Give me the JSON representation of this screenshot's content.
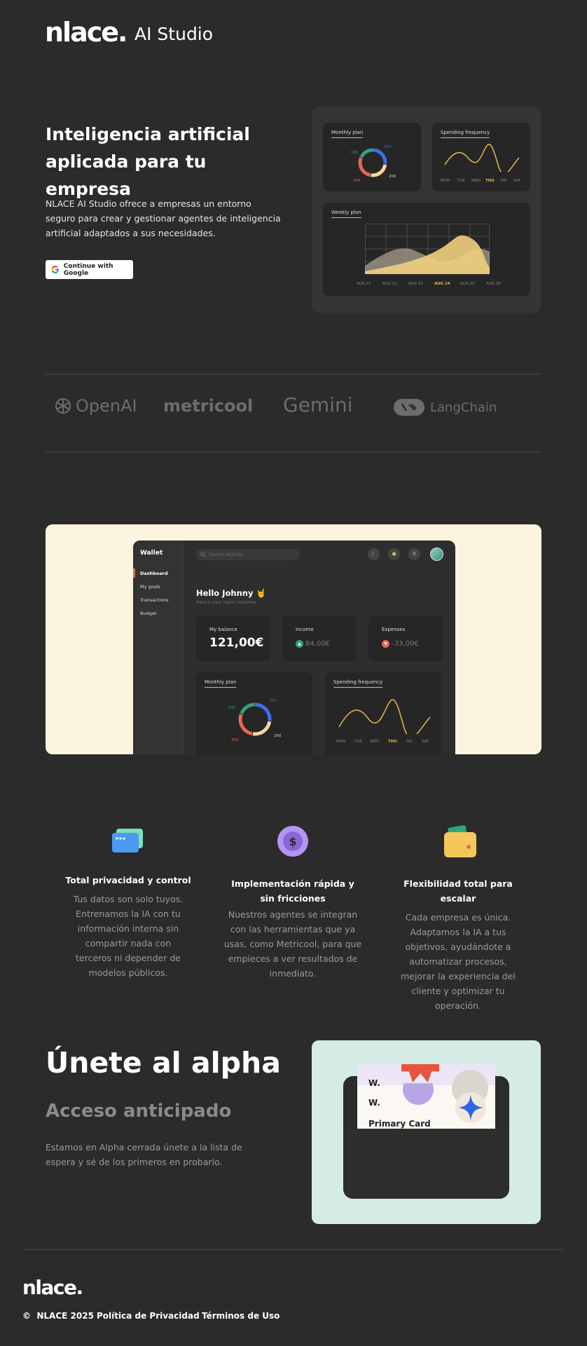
{
  "header": {
    "logo": "nlace.",
    "logo_sub": "AI Studio"
  },
  "hero": {
    "title": "Inteligencia artificial aplicada para tu empresa",
    "description": "NLACE AI Studio ofrece a empresas un entorno seguro para crear y gestionar agentes de inteligencia artificial adaptados a sus necesidades.",
    "google_button": "Continue with Google",
    "monthly_card": {
      "title": "Monthly plan",
      "labels": [
        "100",
        "300",
        "300",
        "200"
      ]
    },
    "spending_card": {
      "title": "Spending frequency",
      "days": [
        "MON",
        "TUE",
        "WED",
        "THU",
        "FRI",
        "SAT"
      ],
      "active_day": "THU"
    },
    "weekly_card": {
      "title": "Weekly plan",
      "dates": [
        "AUG 21",
        "AUG 22",
        "AUG 23",
        "AUG 24",
        "AUG 25",
        "AUG 26"
      ],
      "active_date": "AUG 24"
    }
  },
  "partners": [
    "OpenAI",
    "metricool",
    "Gemini",
    "LangChain"
  ],
  "showcase": {
    "app_title": "Wallet",
    "nav": [
      "Dashboard",
      "My goals",
      "Transactions",
      "Budget"
    ],
    "search_placeholder": "Search Activity",
    "greeting": "Hello Johnny 🤘",
    "greeting_sub": "Here is your report overview",
    "balance_label": "My balance",
    "balance_value": "121,00€",
    "income_label": "Income",
    "income_value": "84,00€",
    "expenses_label": "Expenses",
    "expenses_value": "-33,00€",
    "monthly_title": "Monthly plan",
    "monthly_labels": [
      "100",
      "300",
      "300",
      "200"
    ],
    "spending_title": "Spending frequency",
    "days": [
      "MON",
      "TUE",
      "WED",
      "THU",
      "FRI",
      "SAT"
    ]
  },
  "features": [
    {
      "title": "Total privacidad y control",
      "description": "Tus datos son solo tuyos. Entrenamos la IA con tu información interna sin compartir nada con terceros ni depender de modelos públicos."
    },
    {
      "title": "Implementación rápida y sin fricciones",
      "description": "Nuestros agentes se integran con las herramientas que ya usas, como Metricool, para que empieces a ver resultados de inmediato."
    },
    {
      "title": "Flexibilidad total para escalar",
      "description": "Cada empresa es única. Adaptamos la IA a tus objetivos, ayudándote a automatizar procesos, mejorar la experiencia del cliente y optimizar tu operación."
    }
  ],
  "alpha": {
    "title": "Únete al alpha",
    "subtitle": "Acceso anticipado",
    "description": "Estamos en Alpha cerrada únete a la lista de espera y sé de los primeros en probarlo.",
    "card_w1": "W.",
    "card_w2": "W.",
    "card_label": "Primary Card"
  },
  "footer": {
    "logo": "nlace.",
    "copyright": "©  NLACE 2025",
    "privacy": "Política de Privacidad",
    "terms": "Términos de Uso"
  }
}
